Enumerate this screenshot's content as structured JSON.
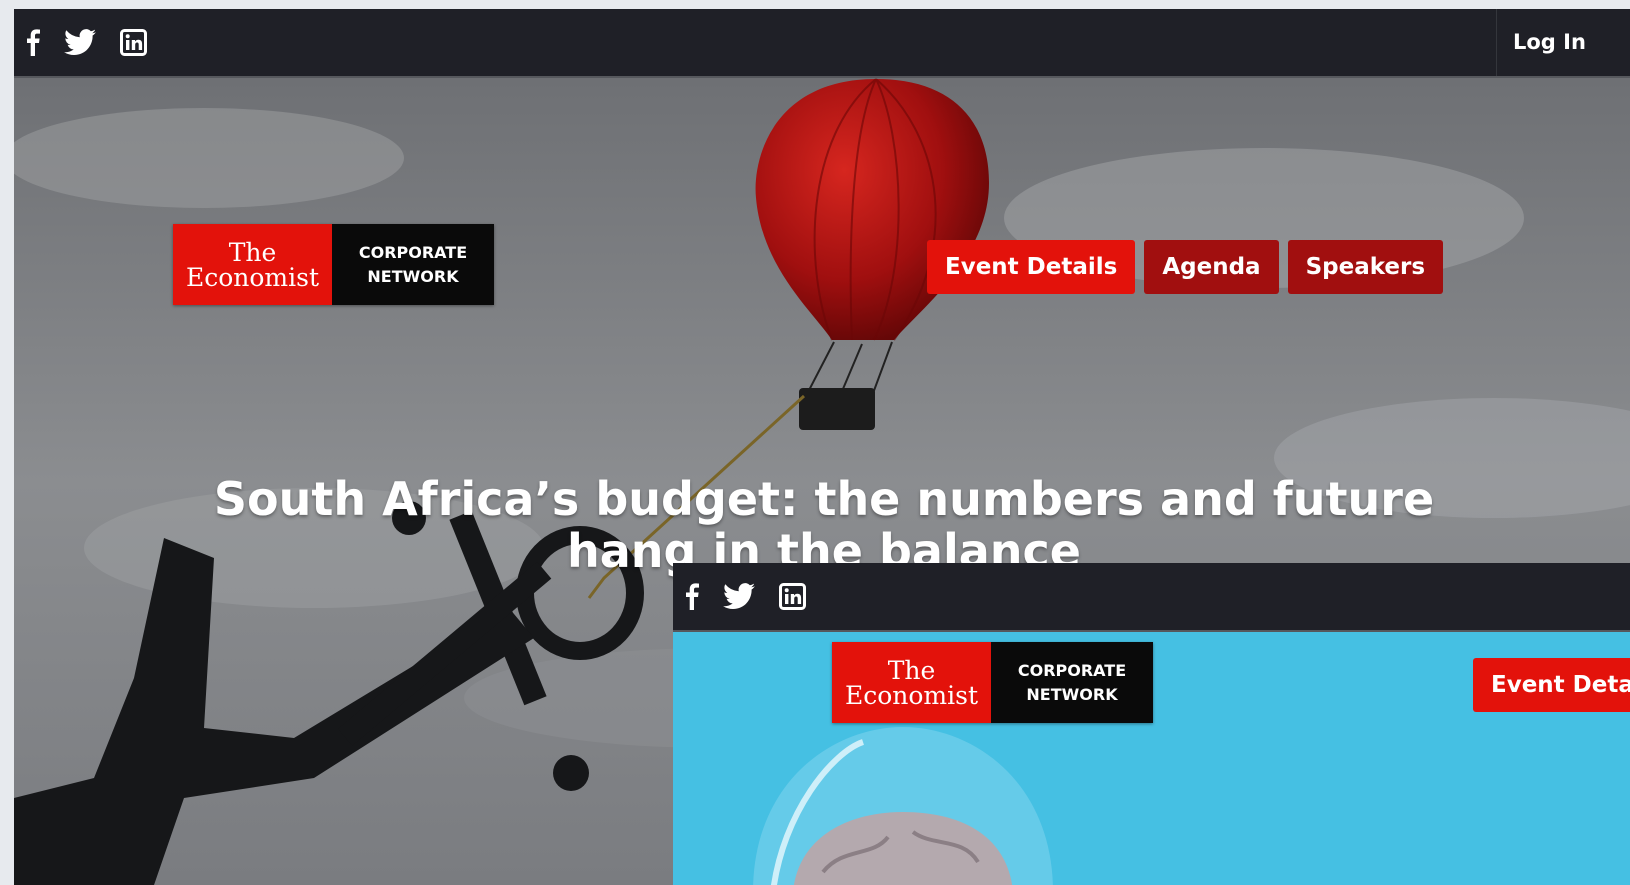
{
  "windows": [
    {
      "social": [
        "facebook-icon",
        "twitter-icon",
        "linkedin-icon"
      ],
      "login_label": "Log In",
      "logo": {
        "line1": "The",
        "line2": "Economist",
        "line3": "CORPORATE",
        "line4": "NETWORK"
      },
      "nav": [
        {
          "label": "Event Details",
          "active": true
        },
        {
          "label": "Agenda",
          "active": false
        },
        {
          "label": "Speakers",
          "active": false
        }
      ],
      "headline": "South Africa’s budget: the numbers and future hang in the balance",
      "hero_image": "red-hot-air-balloon-tied-to-anchor"
    },
    {
      "social": [
        "facebook-icon",
        "twitter-icon",
        "linkedin-icon"
      ],
      "logo": {
        "line1": "The",
        "line2": "Economist",
        "line3": "CORPORATE",
        "line4": "NETWORK"
      },
      "nav": [
        {
          "label": "Event Details",
          "active": true
        }
      ],
      "hero_image": "brain-in-glass-dome-on-blue"
    }
  ],
  "colors": {
    "topbar": "#1f2027",
    "economist_red": "#e3120b",
    "nav_dark_red": "#a10f0f",
    "hero2_blue": "#45c0e3"
  }
}
